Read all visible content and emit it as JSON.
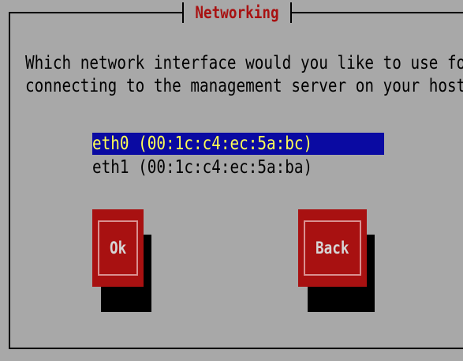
{
  "dialog": {
    "title": "Networking",
    "question_lines": [
      "Which network interface would you like to use for",
      "connecting to the management server on your host?"
    ],
    "interfaces": [
      {
        "label": "eth0 (00:1c:c4:ec:5a:bc)",
        "selected": true
      },
      {
        "label": "eth1 (00:1c:c4:ec:5a:ba)",
        "selected": false
      }
    ],
    "buttons": {
      "ok_label": "Ok",
      "back_label": "Back"
    }
  },
  "colors": {
    "background": "#a8a8a8",
    "title": "#a81111",
    "button": "#a81111",
    "selection_bg": "#0a0aa2",
    "selection_fg": "#ffff55",
    "shadow": "#000000"
  }
}
